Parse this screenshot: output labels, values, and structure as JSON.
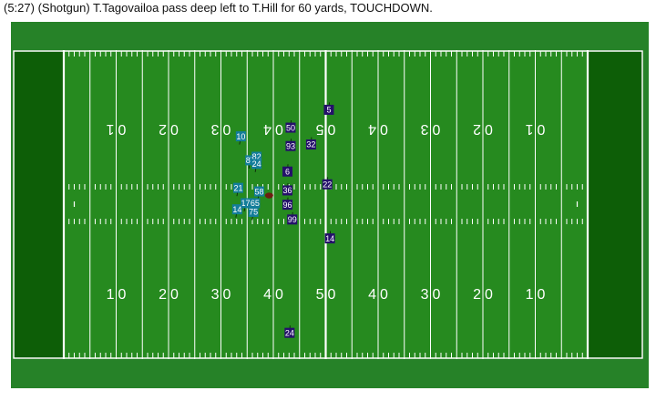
{
  "play": {
    "description": "(5:27) (Shotgun) T.Tagovailoa pass deep left to T.Hill for 60 yards, TOUCHDOWN."
  },
  "colors": {
    "outer_green": "#268228",
    "field_green": "#268a1f",
    "endzone_green": "#0d5e07",
    "line_white": "#ffffff",
    "offense_team": "#137d9a",
    "defense_team": "#24106a",
    "ball": "#6b1e10"
  },
  "field": {
    "yard_numbers": [
      {
        "label": "10",
        "yard": 10
      },
      {
        "label": "20",
        "yard": 20
      },
      {
        "label": "30",
        "yard": 30
      },
      {
        "label": "40",
        "yard": 40
      },
      {
        "label": "50",
        "yard": 50
      },
      {
        "label": "40",
        "yard": 60
      },
      {
        "label": "30",
        "yard": 70
      },
      {
        "label": "20",
        "yard": 80
      },
      {
        "label": "10",
        "yard": 90
      }
    ]
  },
  "ball": {
    "yard": 39.2,
    "lateral": 26.6
  },
  "players": [
    {
      "number": "10",
      "team": "offense",
      "yard": 33.8,
      "lateral": 38.2
    },
    {
      "number": "87",
      "team": "offense",
      "yard": 35.6,
      "lateral": 33.5
    },
    {
      "number": "82",
      "team": "offense",
      "yard": 36.8,
      "lateral": 34.2
    },
    {
      "number": "24",
      "team": "offense",
      "yard": 36.8,
      "lateral": 32.8
    },
    {
      "number": "21",
      "team": "offense",
      "yard": 33.3,
      "lateral": 28.1
    },
    {
      "number": "58",
      "team": "offense",
      "yard": 37.3,
      "lateral": 27.4
    },
    {
      "number": "17",
      "team": "offense",
      "yard": 34.7,
      "lateral": 25.1
    },
    {
      "number": "65",
      "team": "offense",
      "yard": 36.5,
      "lateral": 25.1
    },
    {
      "number": "14",
      "team": "offense",
      "yard": 33.1,
      "lateral": 23.9
    },
    {
      "number": "75",
      "team": "offense",
      "yard": 36.2,
      "lateral": 23.4
    },
    {
      "number": "50",
      "team": "defense",
      "yard": 43.3,
      "lateral": 39.9
    },
    {
      "number": "5",
      "team": "defense",
      "yard": 50.6,
      "lateral": 43.4
    },
    {
      "number": "93",
      "team": "defense",
      "yard": 43.3,
      "lateral": 36.3
    },
    {
      "number": "32",
      "team": "defense",
      "yard": 47.2,
      "lateral": 36.6
    },
    {
      "number": "6",
      "team": "defense",
      "yard": 42.7,
      "lateral": 31.3
    },
    {
      "number": "22",
      "team": "defense",
      "yard": 50.3,
      "lateral": 28.8
    },
    {
      "number": "36",
      "team": "defense",
      "yard": 42.7,
      "lateral": 27.6
    },
    {
      "number": "96",
      "team": "defense",
      "yard": 42.7,
      "lateral": 24.8
    },
    {
      "number": "99",
      "team": "defense",
      "yard": 43.6,
      "lateral": 21.9
    },
    {
      "number": "14",
      "team": "defense",
      "yard": 50.8,
      "lateral": 18.2
    },
    {
      "number": "24",
      "team": "defense",
      "yard": 43.1,
      "lateral": -0.3
    }
  ]
}
